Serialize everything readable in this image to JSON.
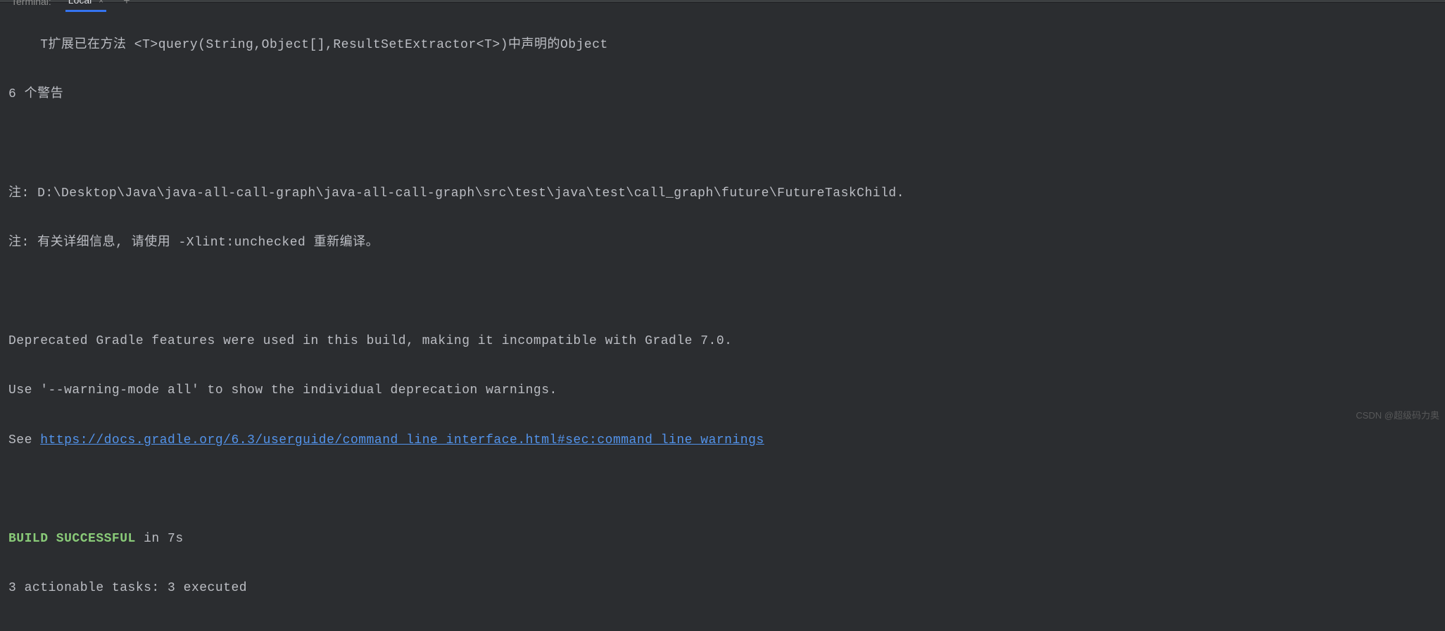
{
  "tabs": {
    "terminal_label": "Terminal:",
    "local_label": "Local",
    "close_symbol": "×",
    "add_symbol": "+"
  },
  "terminal": {
    "line1": "    T扩展已在方法 <T>query(String,Object[],ResultSetExtractor<T>)中声明的Object",
    "line2": "6 个警告",
    "line3": "",
    "line4": "注: D:\\Desktop\\Java\\java-all-call-graph\\java-all-call-graph\\src\\test\\java\\test\\call_graph\\future\\FutureTaskChild.",
    "line5": "注: 有关详细信息, 请使用 -Xlint:unchecked 重新编译。",
    "line6": "",
    "line7": "Deprecated Gradle features were used in this build, making it incompatible with Gradle 7.0.",
    "line8": "Use '--warning-mode all' to show the individual deprecation warnings.",
    "line9_prefix": "See ",
    "line9_link": "https://docs.gradle.org/6.3/userguide/command_line_interface.html#sec:command_line_warnings",
    "line10": "",
    "line11_success": "BUILD SUCCESSFUL",
    "line11_rest": " in 7s",
    "line12": "3 actionable tasks: 3 executed"
  },
  "watermark": "CSDN @超级码力奥"
}
